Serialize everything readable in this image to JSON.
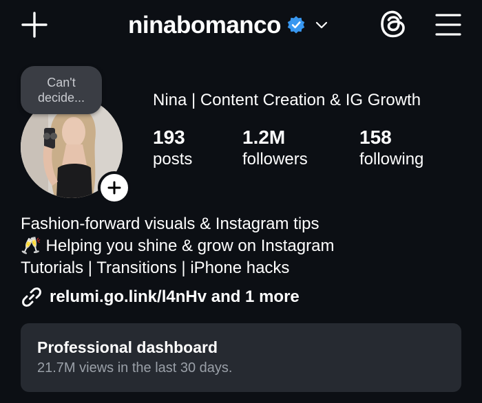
{
  "header": {
    "username": "ninabomanco",
    "verified": true,
    "icons": {
      "create": "plus-icon",
      "verified": "verified-badge-icon",
      "switch": "chevron-down-icon",
      "threads": "threads-icon",
      "menu": "hamburger-menu-icon"
    }
  },
  "profile": {
    "note": {
      "line1": "Can't",
      "line2": "decide..."
    },
    "display_name": "Nina | Content Creation & IG Growth",
    "stats": [
      {
        "value": "193",
        "label": "posts"
      },
      {
        "value": "1.2M",
        "label": "followers"
      },
      {
        "value": "158",
        "label": "following"
      }
    ]
  },
  "bio": {
    "lines": [
      "Fashion-forward visuals & Instagram tips",
      "🥂 Helping you shine & grow on Instagram",
      "Tutorials | Transitions | iPhone hacks"
    ],
    "link": "relumi.go.link/l4nHv and 1 more"
  },
  "dashboard": {
    "title": "Professional dashboard",
    "subtitle": "21.7M views in the last 30 days."
  },
  "colors": {
    "background": "#0c0f14",
    "card": "#262a31",
    "verified_blue": "#3897f0",
    "muted_text": "#9aa0a8"
  }
}
